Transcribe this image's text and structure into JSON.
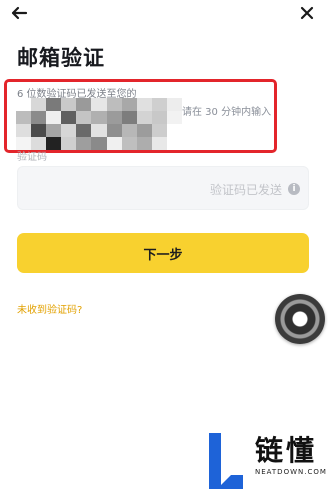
{
  "header": {
    "back_icon": "arrow-left-icon",
    "close_icon": "close-icon",
    "title": "邮箱验证"
  },
  "description": {
    "line1": "6 位数验证码已发送至您的",
    "email_obscured": true,
    "suffix": "请在 30 分钟内输入"
  },
  "code_field": {
    "label": "验证码",
    "status_text": "验证码已发送",
    "info_icon": "info-icon"
  },
  "next_button": {
    "label": "下一步",
    "color": "#f8d12f"
  },
  "resend_link": {
    "label": "未收到验证码?",
    "color": "#e2a100"
  },
  "annotation": {
    "highlight_color": "#e3252b"
  },
  "watermark": {
    "chinese": "链懂",
    "english": "NEATDOWN.COM",
    "accent_color": "#1e63d8"
  }
}
